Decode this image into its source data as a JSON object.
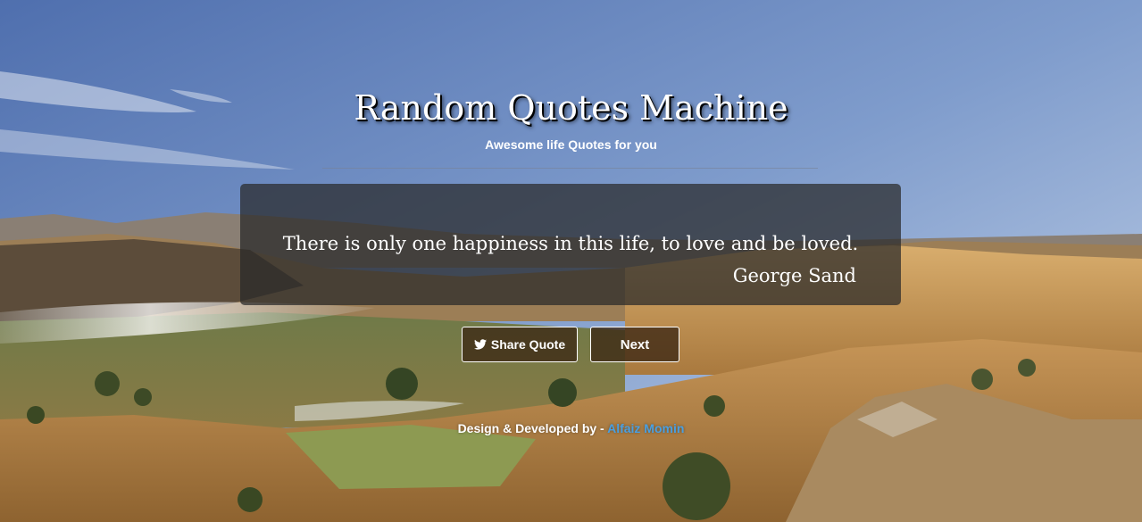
{
  "header": {
    "title": "Random Quotes Machine",
    "subtitle": "Awesome life Quotes for you"
  },
  "quote": {
    "text": "There is only one happiness in this life, to love and be loved.",
    "author": "George Sand"
  },
  "actions": {
    "share_label": "Share Quote",
    "share_icon": "twitter-icon",
    "next_label": "Next"
  },
  "footer": {
    "credit_prefix": "Design & Developed by - ",
    "author_link": "Alfaiz Momin"
  },
  "colors": {
    "link": "#4a9fe0",
    "sky_top": "#5a7ab5",
    "hills": "#c89a5a"
  }
}
